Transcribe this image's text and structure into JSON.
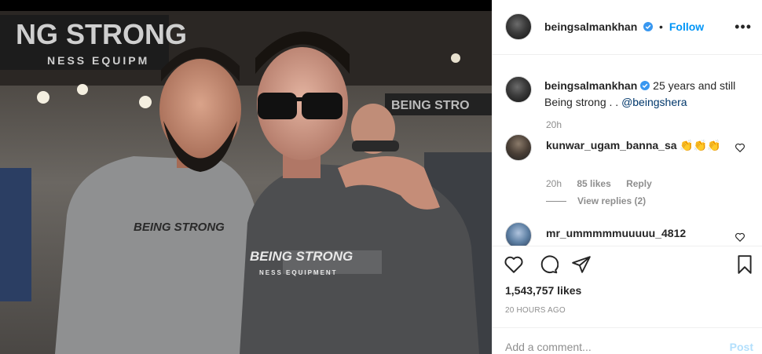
{
  "post": {
    "image_icon": "photo-two-men-being-strong",
    "image_text": {
      "banner_big": "NG STRONG",
      "banner_small": "NESS EQUIPM",
      "right_banner": "BEING STRO",
      "shirt1": "BEING STRONG",
      "shirt2": "BEING STRONG",
      "shirt2_sub": "NESS EQUIPMENT"
    }
  },
  "header": {
    "username": "beingsalmankhan",
    "dot": "•",
    "follow": "Follow",
    "more": "•••"
  },
  "caption": {
    "username": "beingsalmankhan",
    "text": "25 years and still Being strong . . ",
    "mention": "@beingshera",
    "time": "20h"
  },
  "comments": [
    {
      "username": "kunwar_ugam_banna_sa",
      "emoji": "👏👏👏",
      "time": "20h",
      "likes": "85 likes",
      "reply": "Reply",
      "view_replies": "View replies (2)"
    },
    {
      "username": "mr_ummmmmuuuuu_4812"
    }
  ],
  "actions": {
    "likes": "1,543,757 likes",
    "ago": "20 HOURS AGO"
  },
  "add_comment": {
    "placeholder": "Add a comment...",
    "post": "Post"
  },
  "colors": {
    "link_blue": "#0095f6",
    "muted": "#8e8e8e",
    "post_disabled": "#b2dffc"
  }
}
